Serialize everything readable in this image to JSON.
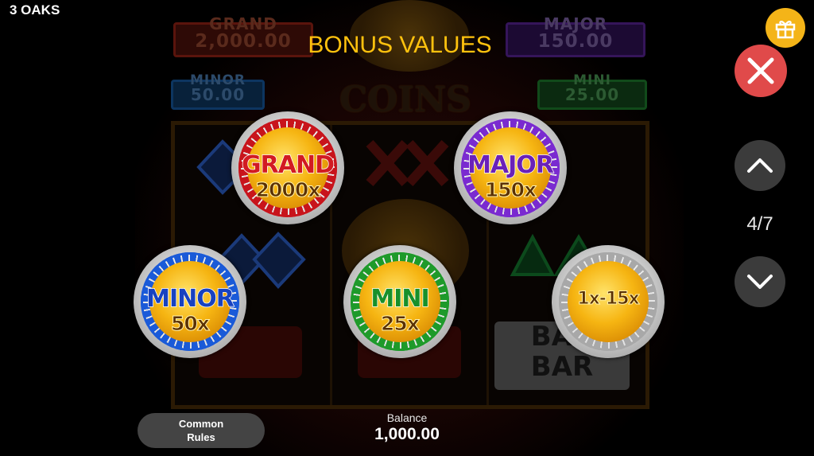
{
  "app": {
    "brand": "3 OAKS"
  },
  "page": {
    "heading": "BONUS VALUES",
    "counter": "4/7"
  },
  "background_scene": {
    "jackpots": {
      "grand": {
        "title": "GRAND",
        "value": "2,000.00"
      },
      "major": {
        "title": "MAJOR",
        "value": "150.00"
      },
      "minor": {
        "title": "MINOR",
        "value": "50.00"
      },
      "mini": {
        "title": "MINI",
        "value": "25.00"
      }
    },
    "logo": "COINS",
    "bar_symbol": {
      "top": "BAR",
      "bottom": "BAR"
    }
  },
  "coins": [
    {
      "name": "GRAND",
      "multiplier": "2000x",
      "ring_color": "#c8141c",
      "text_color": "#d21b22"
    },
    {
      "name": "MAJOR",
      "multiplier": "150x",
      "ring_color": "#7a2ad0",
      "text_color": "#6a21b8"
    },
    {
      "name": "MINOR",
      "multiplier": "50x",
      "ring_color": "#1a5ad8",
      "text_color": "#1842c0"
    },
    {
      "name": "MINI",
      "multiplier": "25x",
      "ring_color": "#1e9a2a",
      "text_color": "#18902a"
    },
    {
      "name": "",
      "multiplier": "1x-15x",
      "ring_color": "#a8a8a8",
      "text_color": "#5a3000"
    }
  ],
  "controls": {
    "common_rules": "Common\nRules",
    "balance_label": "Balance",
    "balance_value": "1,000.00"
  },
  "icons": {
    "gift": "gift-icon",
    "close": "close-icon",
    "up": "chevron-up-icon",
    "down": "chevron-down-icon"
  },
  "colors": {
    "heading": "#ffc20e",
    "gift_button": "#f4b418",
    "close_button": "#e04a4a",
    "nav_button": "#3b3b3b"
  }
}
